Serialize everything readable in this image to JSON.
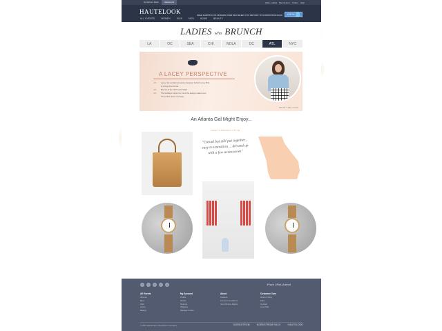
{
  "topbar": {
    "tabs": [
      "Nordstrom Rack",
      "HauteLook"
    ],
    "active_tab": "HauteLook",
    "util": [
      "Hello, Ladies",
      "My Account",
      "Orders",
      "Help"
    ]
  },
  "header": {
    "logo": "HAUTELOOK",
    "nav": [
      "ALL EVENTS",
      "WOMEN",
      "KIDS",
      "MEN",
      "HOME",
      "BEAUTY"
    ],
    "promo": "FREE SHIPPING ON ORDERS OVER $100 WHEN YOU RETURN TO NORDSTROM RACK",
    "login_label": "LOG IN"
  },
  "title": {
    "part1": "LADIES",
    "amp": "who",
    "part2": "BRUNCH"
  },
  "cities": [
    "LA",
    "OC",
    "SEA",
    "CHI",
    "NOLA",
    "DC",
    "ATL",
    "NYC"
  ],
  "active_city": "ATL",
  "banner": {
    "heading": "A LACEY PERSPECTIVE",
    "items": [
      {
        "k": "ATL",
        "v": "Lacey, the acclaimed jewelry designer behind Lacey Bird,"
      },
      {
        "k": "",
        "v": "is a huge brunch fan."
      },
      {
        "k": "ATL",
        "v": "Brunch at the Old Fourth Ward"
      },
      {
        "k": "ATL",
        "v": "The holidays inspire her, and she always makes sure"
      },
      {
        "k": "",
        "v": "the perfect piece of jewelry"
      }
    ],
    "signature": "SHOP THE LOOK"
  },
  "section_title": "An Atlanta Gal Might Enjoy...",
  "quote": {
    "tag": "LACEY'S BRUNCH STYLE",
    "text": "\"Casual but still put together... easy to transition ... dressed up with a few accessories\""
  },
  "footer": {
    "social": [
      "f",
      "t",
      "p",
      "i",
      "g"
    ],
    "apps": "iPhone | iPad | Android",
    "columns": [
      {
        "title": "All Events",
        "links": [
          "Women",
          "Men",
          "Kids",
          "Home",
          "Beauty"
        ]
      },
      {
        "title": "My Account",
        "links": [
          "Profile",
          "Orders",
          "Returns",
          "Shipping",
          "Manage Invites"
        ]
      },
      {
        "title": "About",
        "links": [
          "Careers",
          "Terms & Conditions",
          "Your Privacy Rights"
        ]
      },
      {
        "title": "Customer Care",
        "links": [
          "Return Policy",
          "FAQ",
          "Contact",
          "Live Chat"
        ]
      }
    ],
    "copyright": "© 2019 HauteLook, A Nordstrom Company",
    "brands": [
      "NORDSTROM",
      "NORDSTROM RACK",
      "HAUTELOOK"
    ]
  },
  "colors": {
    "navy": "#2c3447",
    "accent": "#c07e63",
    "peach": "#f9cfb1"
  }
}
